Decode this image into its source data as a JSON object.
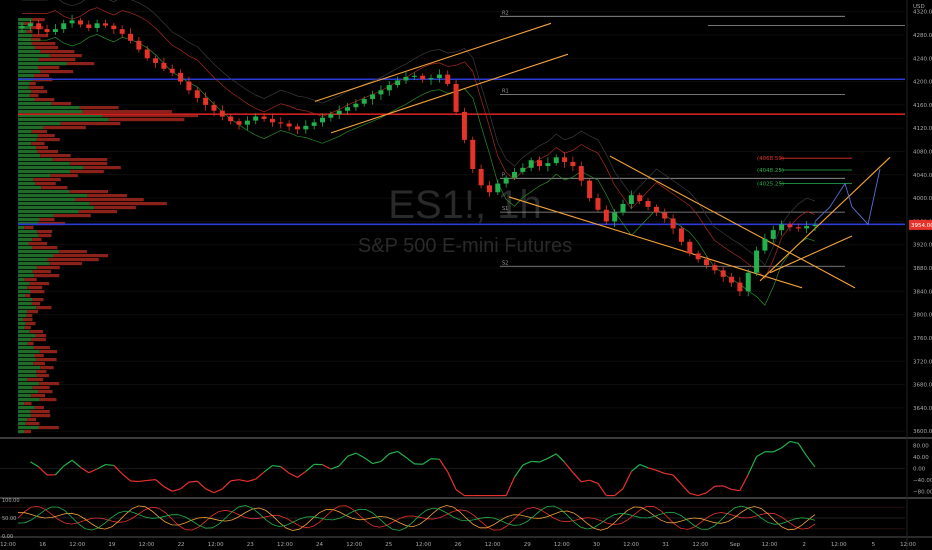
{
  "chart_data": {
    "type": "line",
    "title": "",
    "watermark": {
      "symbol": "ES1!, 1h",
      "name": "S&P 500 E-mini Futures"
    },
    "currency": "USD",
    "price_axis": {
      "ylim": [
        3590,
        4340
      ],
      "ticks": [
        3600,
        3640,
        3680,
        3720,
        3760,
        3800,
        3840,
        3880,
        3920,
        3960,
        4000,
        4040,
        4080,
        4120,
        4160,
        4200,
        4240,
        4280,
        4320
      ],
      "last_price": 3954
    },
    "time_axis": {
      "labels": [
        "12:00",
        "16",
        "12:00",
        "19",
        "12:00",
        "22",
        "12:00",
        "23",
        "12:00",
        "24",
        "12:00",
        "25",
        "12:00",
        "26",
        "12:00",
        "29",
        "12:00",
        "30",
        "12:00",
        "31",
        "12:00",
        "Sep",
        "12:00",
        "2",
        "12:00",
        "5",
        "12:00"
      ]
    },
    "series": [
      {
        "values": [
          4295,
          4300,
          4290,
          4285,
          4290,
          4300,
          4305,
          4298,
          4292,
          4300,
          4296,
          4290,
          4282,
          4270,
          4255,
          4240,
          4232,
          4222,
          4215,
          4200,
          4185,
          4172,
          4160,
          4150,
          4140,
          4132,
          4126,
          4133,
          4140,
          4136,
          4130,
          4128,
          4123,
          4118,
          4124,
          4130,
          4138,
          4144,
          4150,
          4156,
          4162,
          4170,
          4178,
          4185,
          4194,
          4202,
          4208,
          4210,
          4204,
          4206,
          4212,
          4196,
          4148,
          4100,
          4050,
          4022,
          4010,
          4025,
          4035,
          4045,
          4052,
          4065,
          4055,
          4060,
          4070,
          4062,
          4055,
          4030,
          4000,
          3980,
          3960,
          3975,
          3990,
          4005,
          3995,
          3985,
          3975,
          3965,
          3948,
          3925,
          3905,
          3895,
          3885,
          3876,
          3865,
          3855,
          3840,
          3872,
          3910,
          3930,
          3945,
          3955,
          3950,
          3948,
          3952,
          3954
        ]
      }
    ],
    "levels": [
      {
        "label": "R2",
        "price": 4312
      },
      {
        "label": "R1",
        "price": 4178
      },
      {
        "label": "P",
        "price": 4034
      },
      {
        "label": "S1",
        "price": 3976
      },
      {
        "label": "S2",
        "price": 3883
      }
    ],
    "fib_labels": [
      "(4068.50)",
      "(4048.25)",
      "(4025.25)"
    ],
    "horizontal_lines": [
      {
        "price": 4204,
        "color": "#2a3bd8"
      },
      {
        "price": 4144,
        "color": "#d22020"
      },
      {
        "price": 3955,
        "color": "#2a3bd8"
      }
    ],
    "oscillator_1": {
      "ticks": [
        "80.00",
        "40.00",
        "0.00",
        "−40.00",
        "−80.00"
      ],
      "ylim": [
        -100,
        100
      ]
    },
    "oscillator_2": {
      "ticks": [
        "100.00",
        "50.00",
        "0.00"
      ],
      "ylim": [
        0,
        100
      ]
    },
    "colors": {
      "bull": "#22b14c",
      "bear": "#e5332a",
      "channel": "#f2a23a",
      "blue_line": "#2a3bd8",
      "red_line": "#d22020",
      "last_price_bg": "#e5332a"
    }
  }
}
